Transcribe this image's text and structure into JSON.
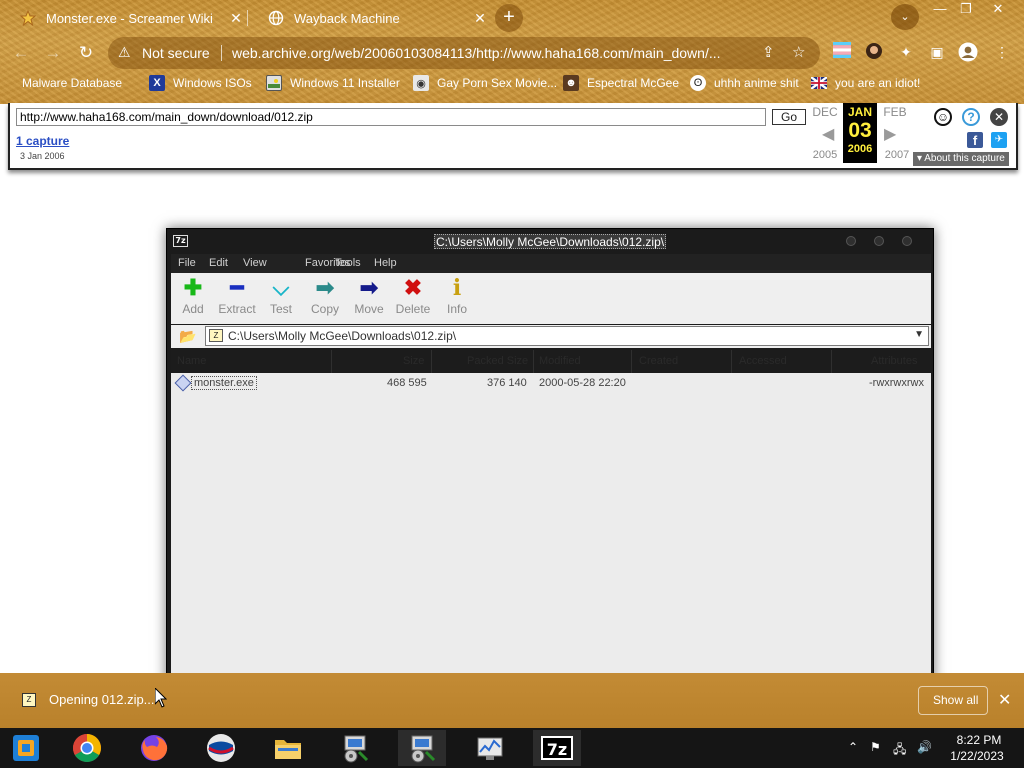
{
  "browser": {
    "tabs": [
      {
        "title": "Monster.exe - Screamer Wiki",
        "icon": "fandom-star-icon"
      },
      {
        "title": "Wayback Machine",
        "icon": "globe-icon"
      }
    ],
    "security_label": "Not secure",
    "url": "web.archive.org/web/20060103084113/http://www.haha168.com/main_down/...",
    "bookmarks": [
      {
        "label": "Malware Database",
        "icon": "folder-icon"
      },
      {
        "label": "Windows ISOs",
        "icon": "x-icon"
      },
      {
        "label": "Windows 11 Installer",
        "icon": "image-icon"
      },
      {
        "label": "Gay Porn Sex Movie...",
        "icon": "globe-icon"
      },
      {
        "label": "Espectral McGee",
        "icon": "avatar-icon"
      },
      {
        "label": "uhhh anime shit",
        "icon": "anime-icon"
      },
      {
        "label": "you are an idiot!",
        "icon": "flag-icon"
      }
    ],
    "theme_color": "#c99237"
  },
  "wayback": {
    "url_value": "http://www.haha168.com/main_down/download/012.zip",
    "go_label": "Go",
    "captures_label": "1 capture",
    "capture_date": "3 Jan 2006",
    "prev_month": "DEC",
    "current_month": "JAN",
    "next_month": "FEB",
    "current_day": "03",
    "prev_year": "2005",
    "current_year": "2006",
    "next_year": "2007",
    "about_label": "About this capture",
    "highlight_color": "#ffef3d"
  },
  "zip": {
    "title": "C:\\Users\\Molly McGee\\Downloads\\012.zip\\",
    "logo": "7z",
    "menu": [
      "File",
      "Edit",
      "View",
      "Favorites",
      "Tools",
      "Help"
    ],
    "tools": [
      {
        "label": "Add",
        "icon": "plus-icon",
        "color": "#18b818"
      },
      {
        "label": "Extract",
        "icon": "minus-icon",
        "color": "#1a2fc0"
      },
      {
        "label": "Test",
        "icon": "check-icon",
        "color": "#19b5c8"
      },
      {
        "label": "Copy",
        "icon": "arrow-right-icon",
        "color": "#2b8a8a"
      },
      {
        "label": "Move",
        "icon": "arrow-right-icon",
        "color": "#141a8a"
      },
      {
        "label": "Delete",
        "icon": "x-icon",
        "color": "#d01010"
      },
      {
        "label": "Info",
        "icon": "info-icon",
        "color": "#c8a010"
      }
    ],
    "path": "C:\\Users\\Molly McGee\\Downloads\\012.zip\\",
    "columns": [
      "Name",
      "Size",
      "Packed Size",
      "Modified",
      "Created",
      "Accessed",
      "Attributes"
    ],
    "files": [
      {
        "name": "monster.exe",
        "size": "468 595",
        "packed": "376 140",
        "modified": "2000-05-28 22:20",
        "attributes": "-rwxrwxrwx"
      }
    ]
  },
  "download_bar": {
    "item_label": "Opening 012.zip...",
    "show_all": "Show all"
  },
  "taskbar": {
    "apps": [
      "vmware-workstation",
      "google-chrome",
      "firefox",
      "opera",
      "file-explorer",
      "network-installer",
      "network-installer-2",
      "resource-monitor",
      "7-zip"
    ],
    "time": "8:22 PM",
    "date": "1/22/2023"
  }
}
